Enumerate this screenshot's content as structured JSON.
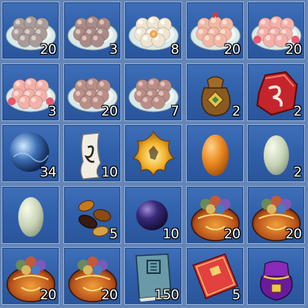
{
  "inventory": {
    "items": [
      {
        "icon": "gray-dumplings-plate-icon",
        "qty": "20"
      },
      {
        "icon": "pink-dumplings-plate-icon",
        "qty": "3"
      },
      {
        "icon": "flower-dumplings-plate-icon",
        "qty": "8"
      },
      {
        "icon": "red-dot-dumplings-plate-icon",
        "qty": "20"
      },
      {
        "icon": "rose-dumplings-plate-icon",
        "qty": "20"
      },
      {
        "icon": "rose-dumplings-plate-icon",
        "qty": "3"
      },
      {
        "icon": "brown-dumplings-plate-icon",
        "qty": "20"
      },
      {
        "icon": "brown-dumplings-plate-icon",
        "qty": "7"
      },
      {
        "icon": "gold-pouch-icon",
        "qty": "2"
      },
      {
        "icon": "red-rune-stone-icon",
        "qty": "2"
      },
      {
        "icon": "blue-orb-icon",
        "qty": "34"
      },
      {
        "icon": "scroll-icon",
        "qty": "10"
      },
      {
        "icon": "golden-flame-icon",
        "qty": ""
      },
      {
        "icon": "orange-egg-icon",
        "qty": ""
      },
      {
        "icon": "jade-egg-icon",
        "qty": "2"
      },
      {
        "icon": "jade-egg-icon",
        "qty": ""
      },
      {
        "icon": "dates-icon",
        "qty": "5"
      },
      {
        "icon": "dark-purple-egg-icon",
        "qty": "10"
      },
      {
        "icon": "treasure-bag-icon",
        "qty": "20"
      },
      {
        "icon": "treasure-bag-icon",
        "qty": "20"
      },
      {
        "icon": "treasure-bag-icon",
        "qty": "20"
      },
      {
        "icon": "treasure-bag-icon",
        "qty": "20"
      },
      {
        "icon": "blue-book-icon",
        "qty": "150"
      },
      {
        "icon": "red-book-icon",
        "qty": "5"
      },
      {
        "icon": "purple-pouch-icon",
        "qty": ""
      }
    ]
  }
}
